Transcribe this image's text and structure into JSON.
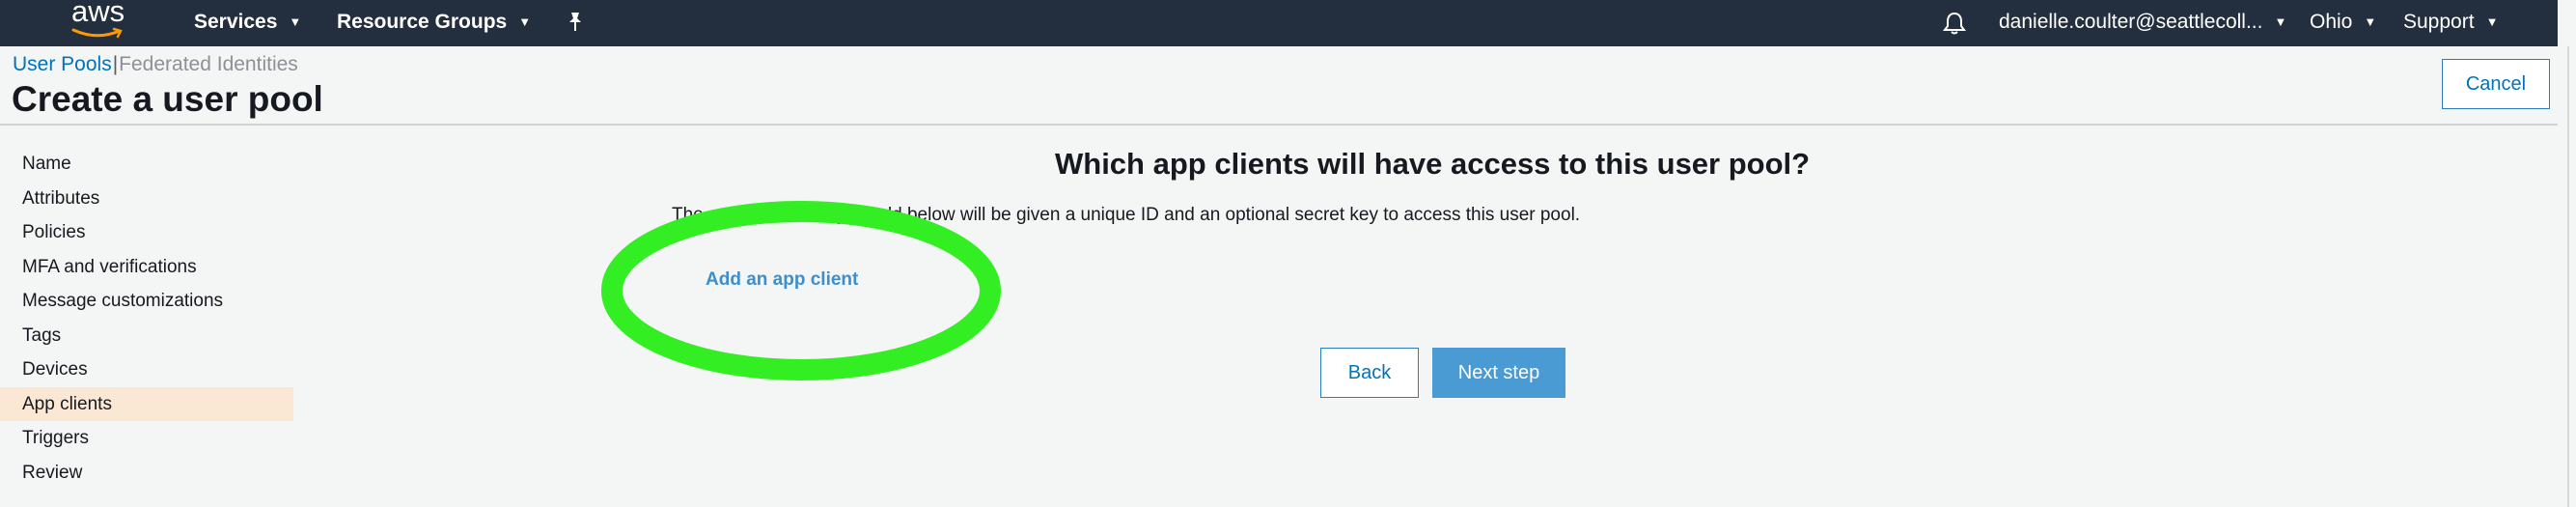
{
  "topnav": {
    "logo_text": "aws",
    "services": "Services",
    "resource_groups": "Resource Groups",
    "user": "danielle.coulter@seattlecoll...",
    "region": "Ohio",
    "support": "Support"
  },
  "breadcrumb": {
    "user_pools": "User Pools",
    "separator": "|",
    "federated": "Federated Identities"
  },
  "page_title": "Create a user pool",
  "cancel_label": "Cancel",
  "sidebar": {
    "items": [
      {
        "label": "Name"
      },
      {
        "label": "Attributes"
      },
      {
        "label": "Policies"
      },
      {
        "label": "MFA and verifications"
      },
      {
        "label": "Message customizations"
      },
      {
        "label": "Tags"
      },
      {
        "label": "Devices"
      },
      {
        "label": "App clients",
        "active": true
      },
      {
        "label": "Triggers"
      },
      {
        "label": "Review"
      }
    ]
  },
  "main": {
    "question": "Which app clients will have access to this user pool?",
    "description": "The app clients that you add below will be given a unique ID and an optional secret key to access this user pool.",
    "add_client": "Add an app client",
    "back_label": "Back",
    "next_label": "Next step"
  },
  "colors": {
    "topbar": "#232f3e",
    "link": "#0073bb",
    "primary_button": "#4a9ad4",
    "active_nav": "#fae8d4",
    "highlight": "#33ee22"
  }
}
